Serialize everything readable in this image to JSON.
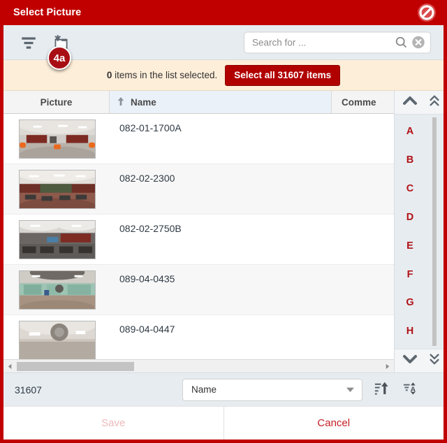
{
  "window": {
    "title": "Select Picture",
    "close_icon": "no-entry-icon"
  },
  "toolbar": {
    "filter_icon": "filter-icon",
    "new_item_icon": "new-item-asterisk-icon",
    "search": {
      "placeholder": "Search for ...",
      "value": "",
      "search_icon": "magnifier-icon",
      "clear_icon": "clear-circle-icon"
    }
  },
  "badge": {
    "label": "4a"
  },
  "infobar": {
    "count": "0",
    "text": " items in the list selected.",
    "select_all_label": "Select all 31607 items"
  },
  "grid": {
    "columns": [
      {
        "key": "picture",
        "label": "Picture"
      },
      {
        "key": "name",
        "label": "Name",
        "sort_icon": "sort-ascending-arrow-icon",
        "sorted": "asc"
      },
      {
        "key": "comment",
        "label": "Comme"
      }
    ],
    "rows": [
      {
        "name": "082-01-1700A",
        "comment": ""
      },
      {
        "name": "082-02-2300",
        "comment": ""
      },
      {
        "name": "082-02-2750B",
        "comment": ""
      },
      {
        "name": "089-04-0435",
        "comment": ""
      },
      {
        "name": "089-04-0447",
        "comment": ""
      }
    ]
  },
  "alpha_index": {
    "up_icon": "chevron-up-icon",
    "down_icon": "chevron-down-icon",
    "page_up_icon": "double-chevron-up-icon",
    "page_down_icon": "double-chevron-down-icon",
    "letters": [
      "A",
      "B",
      "C",
      "D",
      "E",
      "F",
      "G",
      "H"
    ]
  },
  "hscroll": {
    "left_icon": "triangle-left-icon",
    "right_icon": "triangle-right-icon"
  },
  "bottom": {
    "count": "31607",
    "sort_field": "Name",
    "dropdown_icon": "chevron-down-icon",
    "sort_order_icon": "sort-lines-up-icon",
    "sort_alpha_icon": "sort-alpha-toggle-icon"
  },
  "footer": {
    "save_label": "Save",
    "cancel_label": "Cancel"
  },
  "colors": {
    "brand_red": "#c00000",
    "button_red": "#b10000",
    "badge_red": "#a80f14",
    "info_bg": "#fdeed9",
    "toolbar_bg": "#e7ecf0",
    "letter_red": "#b01217",
    "cancel_red": "#c42026",
    "save_disabled": "#edb9ba"
  }
}
